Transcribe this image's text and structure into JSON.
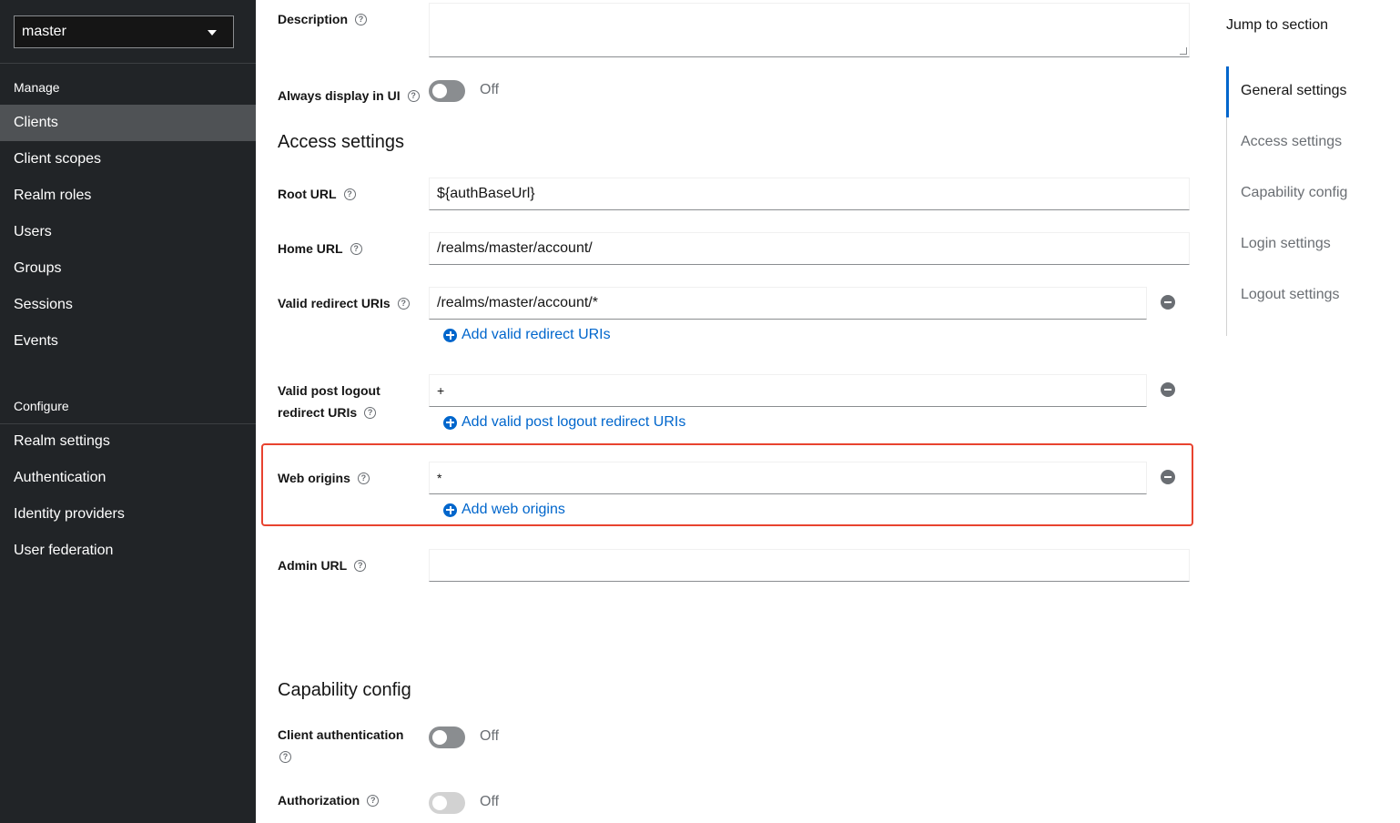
{
  "sidebar": {
    "realm": "master",
    "groups": [
      {
        "title": "Manage",
        "items": [
          {
            "label": "Clients",
            "active": true
          },
          {
            "label": "Client scopes"
          },
          {
            "label": "Realm roles"
          },
          {
            "label": "Users"
          },
          {
            "label": "Groups"
          },
          {
            "label": "Sessions"
          },
          {
            "label": "Events"
          }
        ]
      },
      {
        "title": "Configure",
        "items": [
          {
            "label": "Realm settings"
          },
          {
            "label": "Authentication"
          },
          {
            "label": "Identity providers"
          },
          {
            "label": "User federation"
          }
        ]
      }
    ]
  },
  "form": {
    "description": {
      "label": "Description",
      "value": ""
    },
    "always_display": {
      "label": "Always display in UI",
      "state": "Off"
    },
    "access_settings_title": "Access settings",
    "root_url": {
      "label": "Root URL",
      "value": "${authBaseUrl}"
    },
    "home_url": {
      "label": "Home URL",
      "value": "/realms/master/account/"
    },
    "valid_redirect": {
      "label": "Valid redirect URIs",
      "value": "/realms/master/account/*",
      "add_label": "Add valid redirect URIs"
    },
    "post_logout": {
      "label_line1": "Valid post logout",
      "label_line2": "redirect URIs",
      "value": "+",
      "add_label": "Add valid post logout redirect URIs"
    },
    "web_origins": {
      "label": "Web origins",
      "value": "*",
      "add_label": "Add web origins"
    },
    "admin_url": {
      "label": "Admin URL",
      "value": ""
    },
    "capability_title": "Capability config",
    "client_auth": {
      "label": "Client authentication",
      "state": "Off"
    },
    "authorization": {
      "label": "Authorization",
      "state": "Off"
    }
  },
  "jump": {
    "title": "Jump to section",
    "items": [
      "General settings",
      "Access settings",
      "Capability config",
      "Login settings",
      "Logout settings"
    ],
    "active": "General settings"
  },
  "colors": {
    "sidebar_bg": "#212427",
    "active_item_bg": "#4f5255",
    "link": "#0066cc",
    "highlight": "#e8432f"
  }
}
